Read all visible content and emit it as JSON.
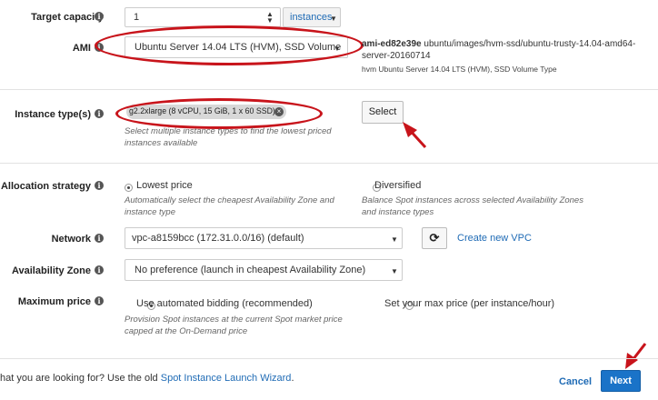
{
  "target_capacity": {
    "label": "Target capacity",
    "value": "1",
    "unit": "instances"
  },
  "ami": {
    "label": "AMI",
    "selected": "Ubuntu Server 14.04 LTS (HVM), SSD Volume",
    "id": "ami-ed82e39e",
    "path": "ubuntu/images/hvm-ssd/ubuntu-trusty-14.04-amd64-server-20160714",
    "description": "hvm Ubuntu Server 14.04 LTS (HVM), SSD Volume Type"
  },
  "instance_types": {
    "label": "Instance type(s)",
    "chip": "g2.2xlarge (8 vCPU, 15 GiB, 1 x 60 SSD)",
    "help": "Select multiple instance types to find the lowest priced instances available",
    "select_button": "Select"
  },
  "allocation": {
    "label": "Allocation strategy",
    "option1": "Lowest price",
    "option1_help": "Automatically select the cheapest Availability Zone and instance type",
    "option2": "Diversified",
    "option2_help": "Balance Spot instances across selected Availability Zones and instance types",
    "selected": "Lowest price"
  },
  "network": {
    "label": "Network",
    "selected": "vpc-a8159bcc (172.31.0.0/16) (default)",
    "create_link": "Create new VPC"
  },
  "availability_zone": {
    "label": "Availability Zone",
    "selected": "No preference (launch in cheapest Availability Zone)"
  },
  "max_price": {
    "label": "Maximum price",
    "option1": "Use automated bidding (recommended)",
    "option1_help": "Provision Spot instances at the current Spot market price capped at the On-Demand price",
    "option2": "Set your max price (per instance/hour)",
    "selected": "Use automated bidding (recommended)"
  },
  "footer": {
    "text": "hat you are looking for? Use the old ",
    "link": "Spot Instance Launch Wizard",
    "link_suffix": ".",
    "cancel": "Cancel",
    "next": "Next"
  },
  "colors": {
    "annotation_red": "#c8141b",
    "link_blue": "#1f6bb5",
    "primary_button": "#1a73c8"
  }
}
